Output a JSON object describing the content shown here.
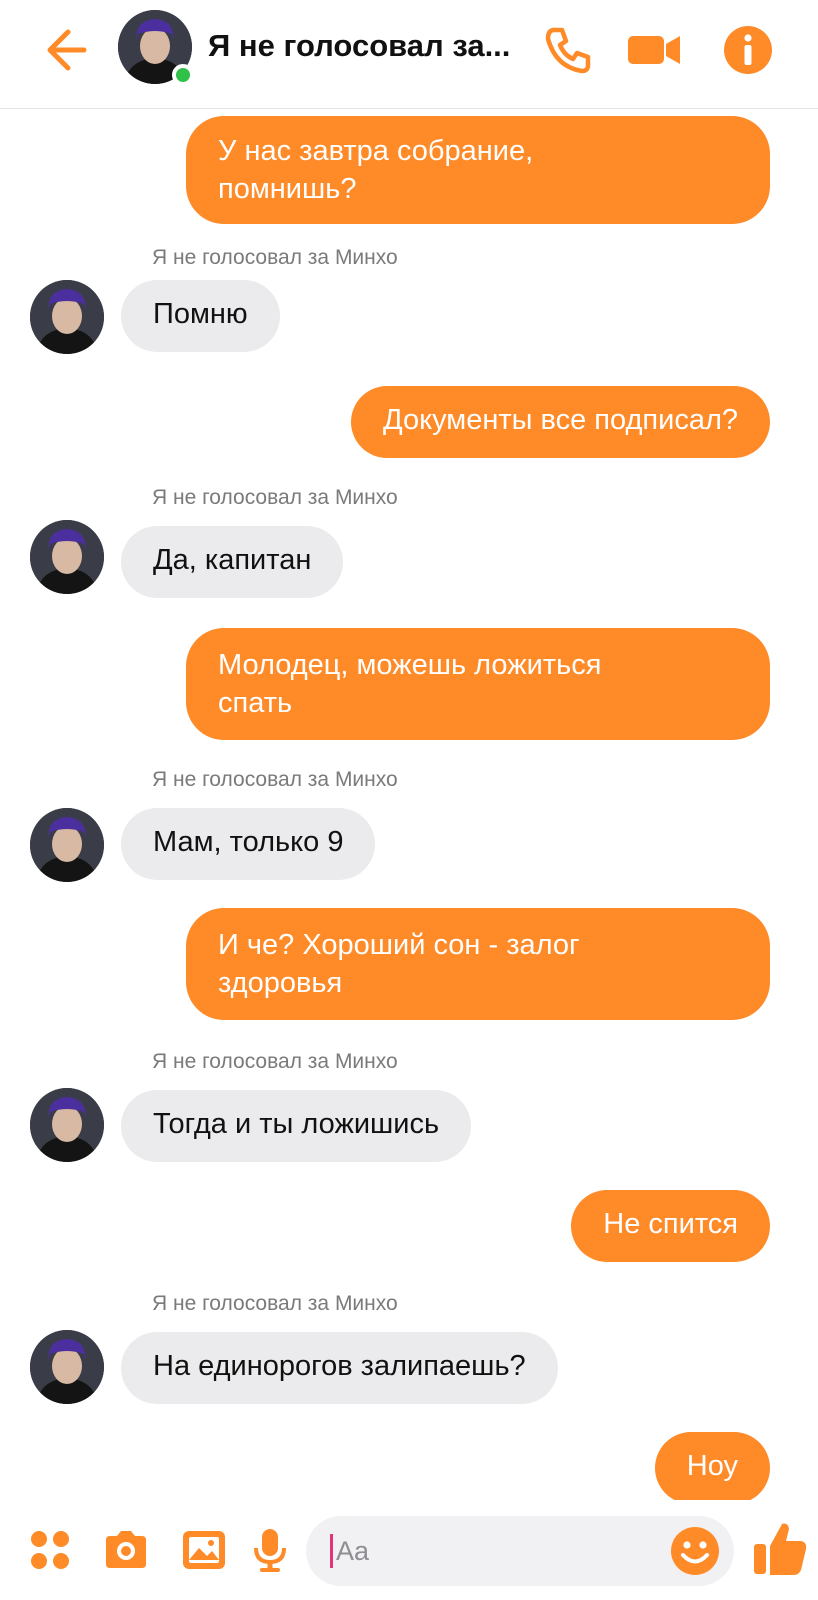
{
  "header": {
    "title": "Я не голосовал за...",
    "icons": [
      "back-arrow-icon",
      "phone-icon",
      "video-camera-icon",
      "info-icon"
    ]
  },
  "colors": {
    "accent": "#fe8a28",
    "incoming_bubble": "#ebebed",
    "online": "#31c048"
  },
  "messages": [
    {
      "dir": "out",
      "text": "У нас завтра собрание,\nпомнишь?"
    },
    {
      "dir": "in",
      "sender": "Я не голосовал за Минхо",
      "text": "Помню"
    },
    {
      "dir": "out",
      "text": "Документы все подписал?"
    },
    {
      "dir": "in",
      "sender": "Я не голосовал за Минхо",
      "text": "Да, капитан"
    },
    {
      "dir": "out",
      "text": "Молодец, можешь ложиться\nспать"
    },
    {
      "dir": "in",
      "sender": "Я не голосовал за Минхо",
      "text": "Мам, только 9"
    },
    {
      "dir": "out",
      "text": "И че? Хороший сон - залог\nздоровья"
    },
    {
      "dir": "in",
      "sender": "Я не голосовал за Минхо",
      "text": "Тогда и ты ложишись"
    },
    {
      "dir": "out",
      "text": "Не спится"
    },
    {
      "dir": "in",
      "sender": "Я не голосовал за Минхо",
      "text": "На единорогов залипаешь?"
    },
    {
      "dir": "out",
      "text": "Ноу"
    }
  ],
  "composer": {
    "placeholder": "Aa",
    "icons": [
      "apps-menu-icon",
      "camera-icon",
      "gallery-icon",
      "microphone-icon",
      "emoji-icon",
      "thumbs-up-icon"
    ]
  }
}
